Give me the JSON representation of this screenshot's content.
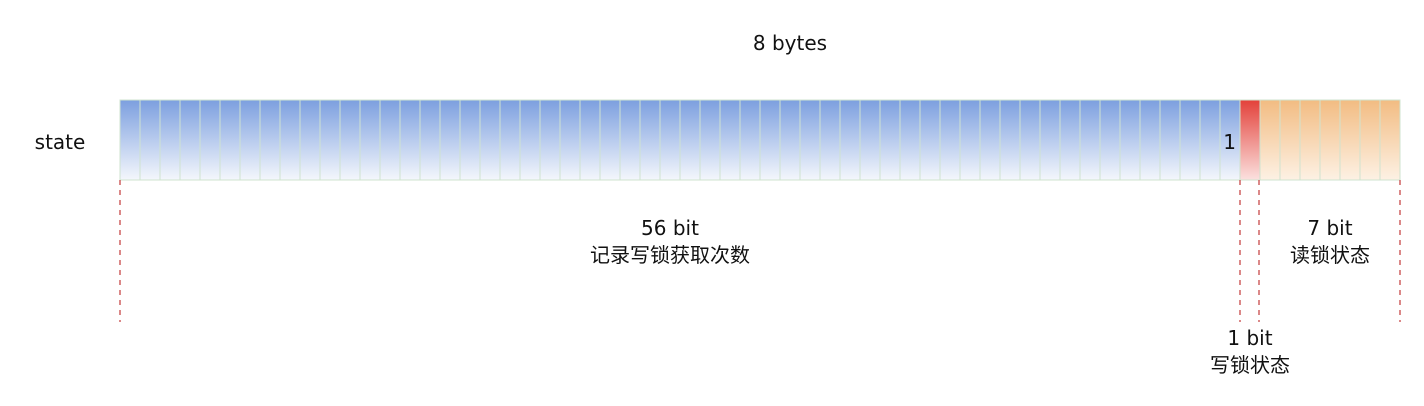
{
  "header": {
    "title": "8 bytes"
  },
  "register": {
    "label": "state",
    "total_bits": 64,
    "segments": [
      {
        "name": "write-count",
        "bits": 56,
        "bits_label": "56 bit",
        "desc": "记录写锁获取次数",
        "color_top": "#7c9fdf",
        "color_bottom": "#f4f7fc"
      },
      {
        "name": "write-lock-state",
        "bits": 1,
        "bits_label": "1 bit",
        "desc": "写锁状态",
        "cell_value": "1",
        "color_top": "#e3413a",
        "color_bottom": "#fbe1df"
      },
      {
        "name": "read-lock-state",
        "bits": 7,
        "bits_label": "7 bit",
        "desc": "读锁状态",
        "color_top": "#f2bc82",
        "color_bottom": "#fdf1e4"
      }
    ],
    "cell_border_color": "#cfe3cf",
    "divider_color": "#c33a3a"
  }
}
